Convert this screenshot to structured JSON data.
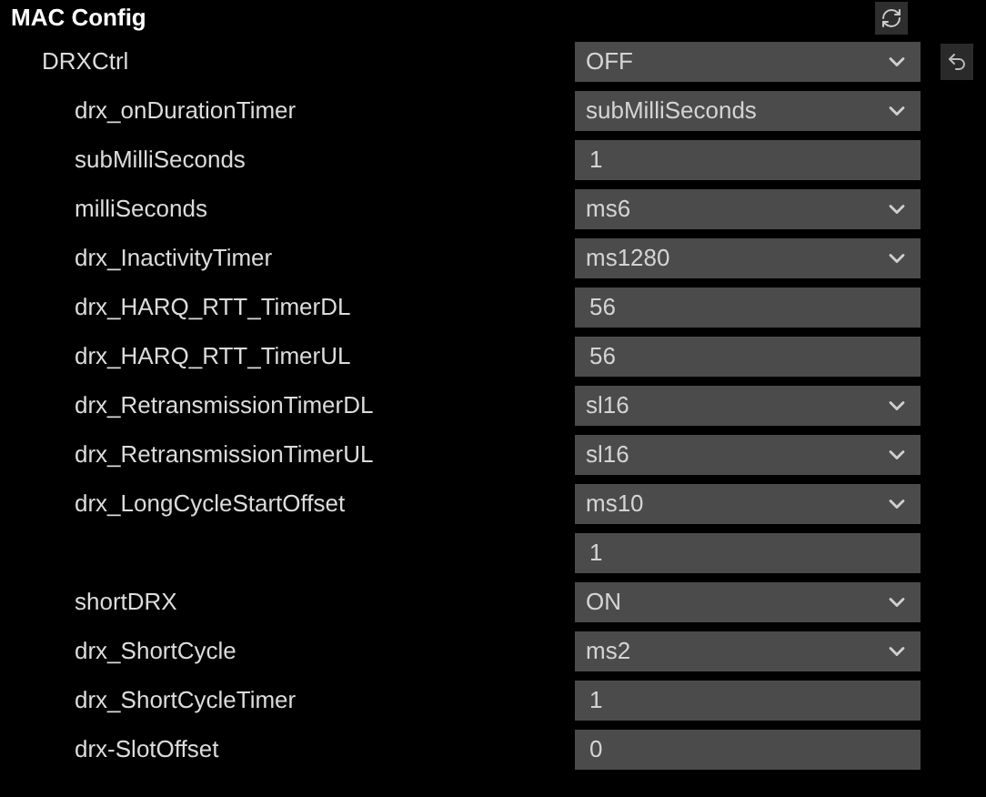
{
  "title": "MAC Config",
  "items": [
    {
      "label": "DRXCtrl",
      "kind": "select",
      "value": "OFF",
      "children": [
        {
          "label": "drx_onDurationTimer",
          "kind": "select",
          "value": "subMilliSeconds"
        },
        {
          "label": "subMilliSeconds",
          "kind": "input",
          "value": "1"
        },
        {
          "label": "milliSeconds",
          "kind": "select",
          "value": "ms6"
        },
        {
          "label": "drx_InactivityTimer",
          "kind": "select",
          "value": "ms1280"
        },
        {
          "label": "drx_HARQ_RTT_TimerDL",
          "kind": "input",
          "value": "56"
        },
        {
          "label": "drx_HARQ_RTT_TimerUL",
          "kind": "input",
          "value": "56"
        },
        {
          "label": "drx_RetransmissionTimerDL",
          "kind": "select",
          "value": "sl16"
        },
        {
          "label": "drx_RetransmissionTimerUL",
          "kind": "select",
          "value": "sl16"
        },
        {
          "label": "drx_LongCycleStartOffset",
          "kind": "select",
          "value": "ms10"
        },
        {
          "kind": "input",
          "value": "1"
        },
        {
          "label": "shortDRX",
          "kind": "select",
          "value": "ON"
        },
        {
          "label": "drx_ShortCycle",
          "kind": "select",
          "value": "ms2"
        },
        {
          "label": "drx_ShortCycleTimer",
          "kind": "input",
          "value": "1"
        },
        {
          "label": "drx-SlotOffset",
          "kind": "input",
          "value": "0"
        }
      ]
    }
  ]
}
